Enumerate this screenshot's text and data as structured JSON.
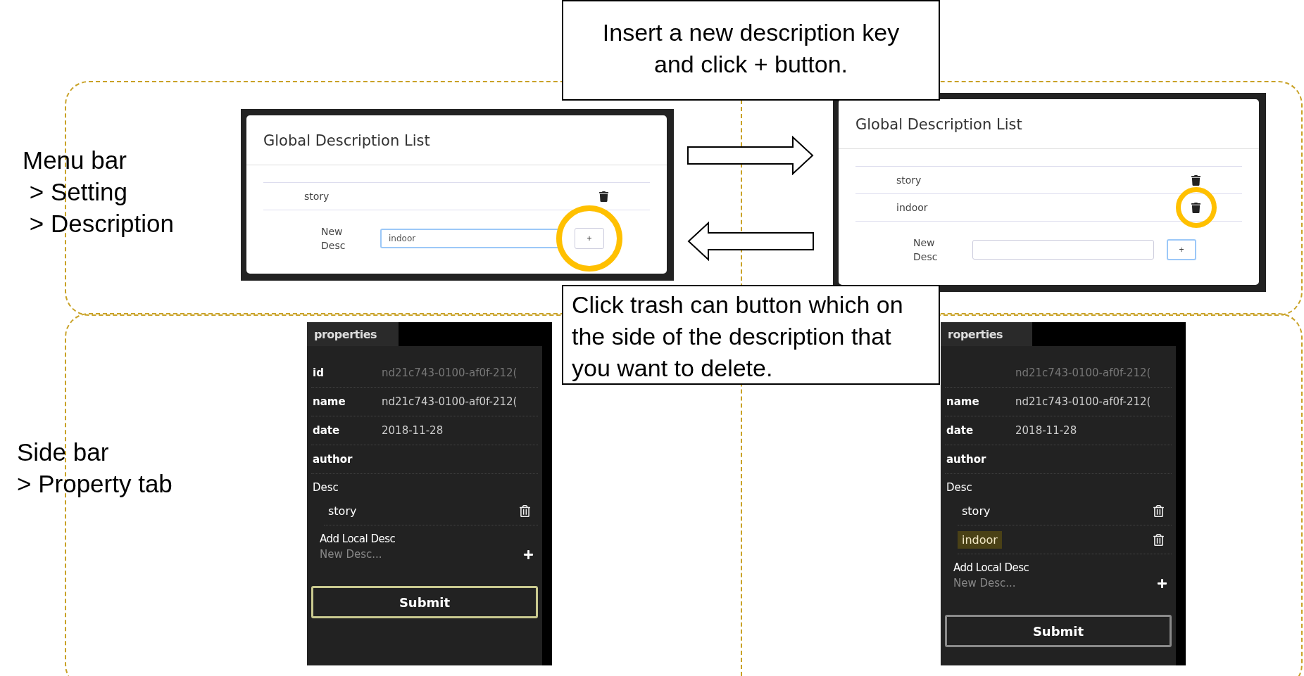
{
  "sections": [
    {
      "label_lines": [
        "Menu bar",
        " > Setting",
        " > Description"
      ]
    },
    {
      "label_lines": [
        "Side bar",
        "> Property tab"
      ]
    }
  ],
  "callouts": [
    "Insert a new description key and click + button.",
    "Click trash can button which on the side of the description that you want to delete."
  ],
  "dialogs": [
    {
      "title": "Global Description List",
      "items": [
        {
          "text": "story",
          "circled": false
        }
      ],
      "new_label": "New Desc",
      "new_value": "indoor",
      "input_focused": true,
      "add_button": "+",
      "add_circled": true
    },
    {
      "title": "Global Description List",
      "items": [
        {
          "text": "story",
          "circled": false
        },
        {
          "text": "indoor",
          "circled": true
        }
      ],
      "new_label": "New Desc",
      "input_focused": false,
      "add_button": "+",
      "add_circled": false
    }
  ],
  "sidebars": [
    {
      "tab": "properties",
      "fields": [
        {
          "label": "id",
          "value": "nd21c743-0100-af0f-212(",
          "disabled": true
        },
        {
          "label": "name",
          "value": "nd21c743-0100-af0f-212(",
          "disabled": false
        },
        {
          "label": "date",
          "value": "2018-11-28",
          "disabled": false
        },
        {
          "label": "author"
        }
      ],
      "desc_label": "Desc",
      "descs": [
        {
          "text": "story",
          "highlighted": false
        }
      ],
      "add_label": "Add Local Desc",
      "placeholder": "New Desc...",
      "submit": "Submit",
      "submit_focused": true
    },
    {
      "tab": "roperties",
      "fields": [
        {
          "value": "nd21c743-0100-af0f-212(",
          "disabled": true
        },
        {
          "label": "name",
          "value": "nd21c743-0100-af0f-212(",
          "disabled": false
        },
        {
          "label": "date",
          "value": "2018-11-28",
          "disabled": false
        },
        {
          "label": "author"
        }
      ],
      "desc_label": "Desc",
      "descs": [
        {
          "text": "story",
          "highlighted": false
        },
        {
          "text": "indoor",
          "highlighted": true
        }
      ],
      "add_label": "Add Local Desc",
      "placeholder": "New Desc...",
      "submit": "Submit",
      "submit_focused": false
    }
  ]
}
